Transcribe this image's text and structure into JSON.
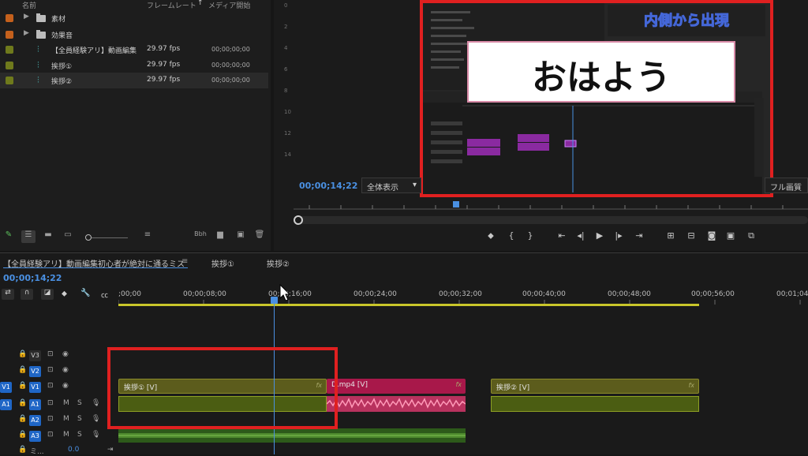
{
  "project_panel": {
    "headers": {
      "name": "名前",
      "framerate": "フレームレート",
      "media_start": "メディア開始"
    },
    "rows": [
      {
        "type": "folder",
        "color": "#c4601c",
        "name": "素材",
        "fps": "",
        "start": ""
      },
      {
        "type": "folder",
        "color": "#c4601c",
        "name": "効果音",
        "fps": "",
        "start": ""
      },
      {
        "type": "sequence",
        "color": "#6f7a1c",
        "name": "【全員経験アリ】動画編集",
        "fps": "29.97 fps",
        "start": "00;00;00;00"
      },
      {
        "type": "sequence",
        "color": "#6f7a1c",
        "name": "挨拶①",
        "fps": "29.97 fps",
        "start": "00;00;00;00"
      },
      {
        "type": "sequence",
        "color": "#6f7a1c",
        "name": "挨拶②",
        "fps": "29.97 fps",
        "start": "00;00;00;00"
      }
    ],
    "toolbar_icons": [
      "pencil-icon",
      "list-view-icon",
      "icon-view-icon",
      "freeform-view-icon",
      "zoom-slider",
      "sort-icon",
      "automate-icon",
      "new-bin-icon",
      "new-item-icon",
      "clear-icon"
    ],
    "bbh": "Bbh"
  },
  "program_monitor": {
    "left_ruler_labels": [
      "0",
      "2",
      "4",
      "6",
      "8",
      "10",
      "12",
      "14"
    ],
    "overlay_title": "内側から出現",
    "caption": "おはよう",
    "timecode": "00;00;14;22",
    "fit": "全体表示",
    "quality": "フル画質"
  },
  "timeline": {
    "tabs": [
      "【全員経験アリ】動画編集初心者が絶対に通るミス",
      "挨拶①",
      "挨拶②"
    ],
    "timecode": "00;00;14;22",
    "ruler": [
      ";00;00",
      "00;00;08;00",
      "00;00;16;00",
      "00;00;24;00",
      "00;00;32;00",
      "00;00;40;00",
      "00;00;48;00",
      "00;00;56;00",
      "00;01;04"
    ],
    "tracks": [
      {
        "name": "V3",
        "source": ""
      },
      {
        "name": "V2",
        "source": ""
      },
      {
        "name": "V1",
        "source": "V1"
      },
      {
        "name": "A1",
        "source": "A1",
        "m": "M",
        "s": "S"
      },
      {
        "name": "A2",
        "source": "",
        "m": "M",
        "s": "S"
      },
      {
        "name": "A3",
        "source": "",
        "m": "M",
        "s": "S"
      }
    ],
    "mix_label": "ミ...",
    "mix_value": "0.0",
    "clips": {
      "v1_a": "挨拶① [V]",
      "v1_b": "D.mp4 [V]",
      "v1_c": "挨拶② [V]",
      "fx": "fx"
    }
  }
}
